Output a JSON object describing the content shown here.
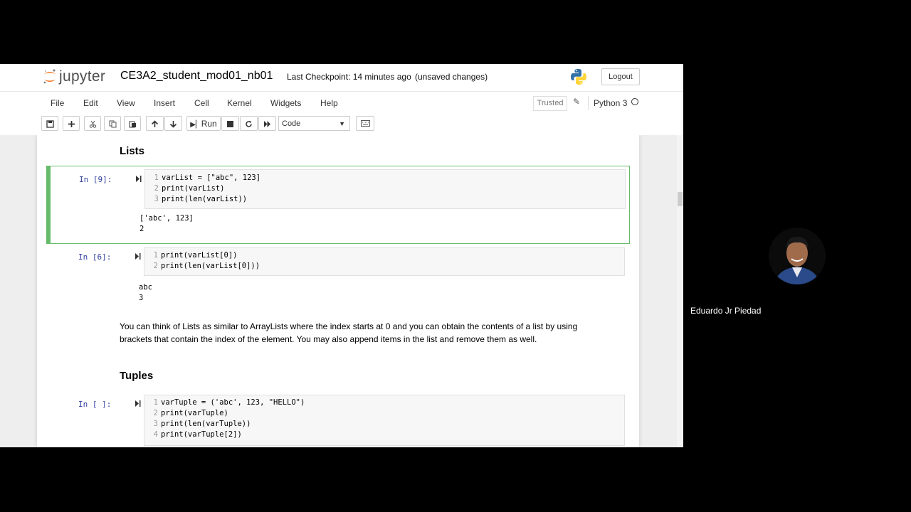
{
  "header": {
    "logo_text": "jupyter",
    "notebook_title": "CE3A2_student_mod01_nb01",
    "checkpoint": "Last Checkpoint: 14 minutes ago",
    "unsaved": "(unsaved changes)",
    "logout_label": "Logout"
  },
  "menubar": {
    "items": [
      "File",
      "Edit",
      "View",
      "Insert",
      "Cell",
      "Kernel",
      "Widgets",
      "Help"
    ],
    "trusted_label": "Trusted",
    "kernel_name": "Python 3"
  },
  "toolbar": {
    "run_label": "Run",
    "cell_type": "Code",
    "icons": [
      "save-icon",
      "plus-icon",
      "cut-icon",
      "copy-icon",
      "paste-icon",
      "arrow-up-icon",
      "arrow-down-icon",
      "run-icon",
      "stop-icon",
      "restart-icon",
      "fast-forward-icon",
      "keyboard-icon"
    ]
  },
  "notebook": {
    "heading_lists": "Lists",
    "cell1": {
      "prompt": "In [9]:",
      "lines": [
        {
          "n": "1",
          "code": "varList = [\"abc\", 123]"
        },
        {
          "n": "2",
          "code": "print(varList)"
        },
        {
          "n": "3",
          "code": "print(len(varList))"
        }
      ],
      "output": [
        "['abc', 123]",
        "2"
      ]
    },
    "cell2": {
      "prompt": "In [6]:",
      "lines": [
        {
          "n": "1",
          "code": "print(varList[0])"
        },
        {
          "n": "2",
          "code": "print(len(varList[0]))"
        }
      ],
      "output": [
        "abc",
        "3"
      ]
    },
    "paragraph_line1": "You can think of Lists as similar to ArrayLists where the index starts at 0 and you can obtain the contents of a list by using",
    "paragraph_line2": "brackets that contain the index of the element. You may also append items in the list and remove them as well.",
    "heading_tuples": "Tuples",
    "cell3": {
      "prompt": "In [ ]:",
      "lines": [
        {
          "n": "1",
          "code": "varTuple = ('abc', 123, \"HELLO\")"
        },
        {
          "n": "2",
          "code": "print(varTuple)"
        },
        {
          "n": "3",
          "code": "print(len(varTuple))"
        },
        {
          "n": "4",
          "code": "print(varTuple[2])"
        }
      ]
    }
  },
  "participant": {
    "name": "Eduardo Jr Piedad"
  }
}
